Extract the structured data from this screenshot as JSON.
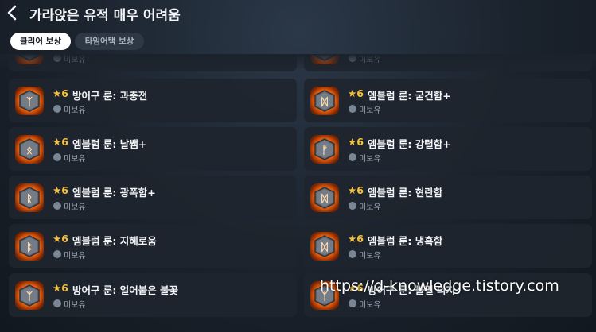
{
  "header": {
    "title": "가라앉은 유적 매우 어려움"
  },
  "tabs": [
    {
      "label": "클리어 보상",
      "active": true
    },
    {
      "label": "타임어택 보상",
      "active": false
    }
  ],
  "status_label": "미보유",
  "grade_label": "★6",
  "rewards": [
    {
      "name": "",
      "glyph": "ᛉ"
    },
    {
      "name": "",
      "glyph": "ᛞ"
    },
    {
      "name": "방어구 룬: 과충전",
      "glyph": "ᛉ"
    },
    {
      "name": "엠블럼 룬: 굳건함+",
      "glyph": "ᛞ"
    },
    {
      "name": "엠블럼 룬: 날쌤+",
      "glyph": "ᛟ"
    },
    {
      "name": "엠블럼 룬: 강렬함+",
      "glyph": "ᚠ"
    },
    {
      "name": "엠블럼 룬: 광폭함+",
      "glyph": "ᚱ"
    },
    {
      "name": "엠블럼 룬: 현란함",
      "glyph": "ᛞ"
    },
    {
      "name": "엠블럼 룬: 지혜로움",
      "glyph": "ᛒ"
    },
    {
      "name": "엠블럼 룬: 냉혹함",
      "glyph": "ᛞ"
    },
    {
      "name": "방어구 룬: 얼어붙은 불꽃",
      "glyph": "ᛉ"
    },
    {
      "name": "방어구 룬: 불멸 의지",
      "glyph": "ᛉ"
    }
  ],
  "watermark": "https://d-knowledge.tistory.com",
  "colors": {
    "star": "#f6c13c",
    "rune_glow": "#ff7a1a",
    "card": "#1e252e"
  }
}
